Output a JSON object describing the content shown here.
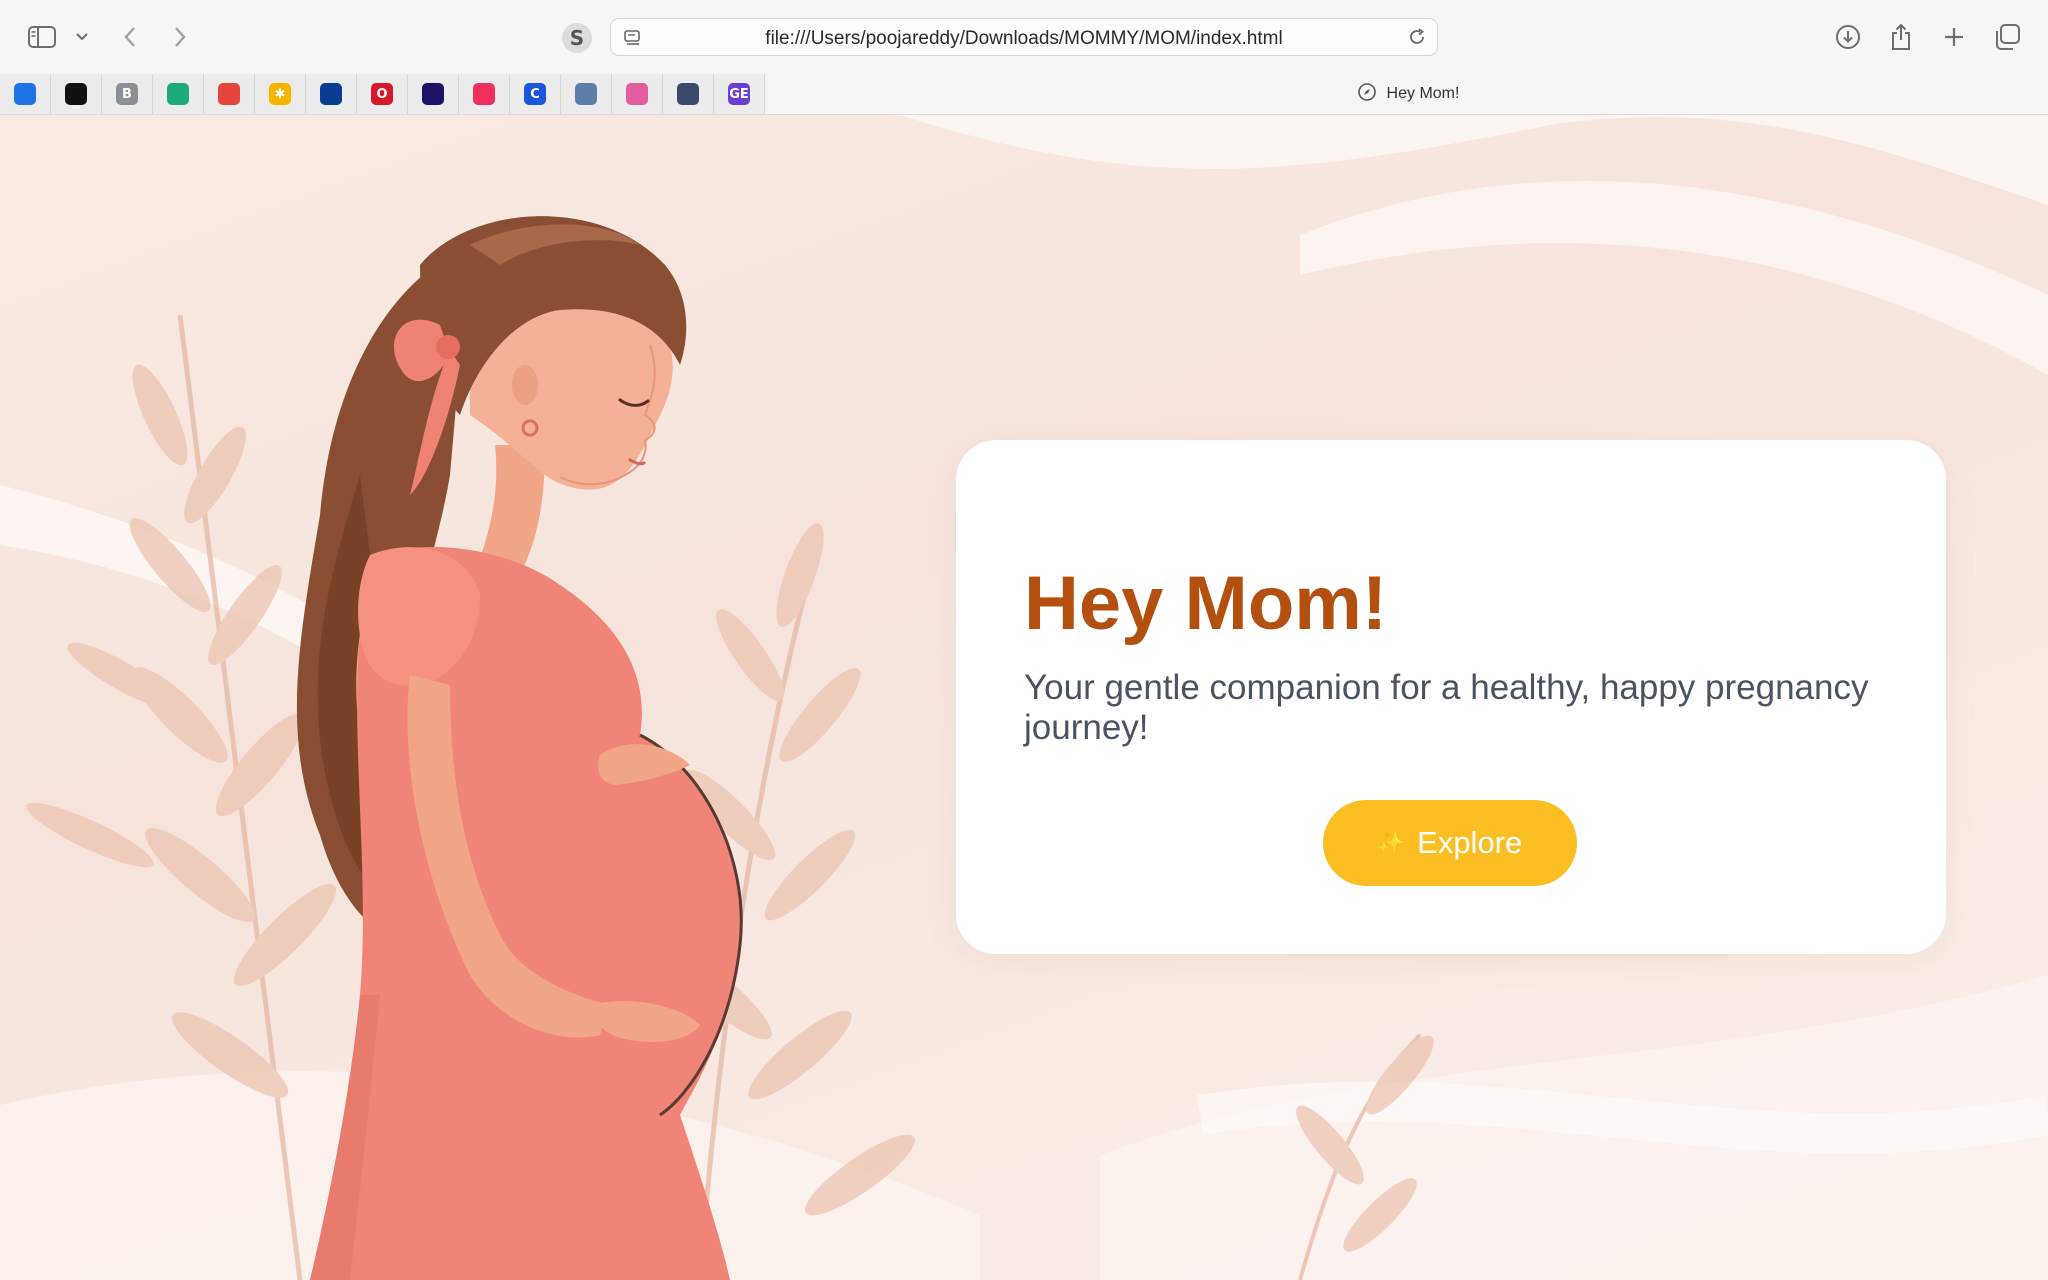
{
  "browser": {
    "url": "file:///Users/poojareddy/Downloads/MOMMY/MOM/index.html",
    "site_badge": "S",
    "active_tab_title": "Hey Mom!",
    "pinned_tabs": [
      {
        "icon": "circle-c-icon",
        "color": "#1e73e8",
        "glyph": ""
      },
      {
        "icon": "github-icon",
        "color": "#111111",
        "glyph": ""
      },
      {
        "icon": "b-icon",
        "color": "#8a8f98",
        "glyph": "B"
      },
      {
        "icon": "robot-icon",
        "color": "#1faa7a",
        "glyph": ""
      },
      {
        "icon": "chrome-icon",
        "color": "#e8453c",
        "glyph": ""
      },
      {
        "icon": "walmart-icon",
        "color": "#f7b500",
        "glyph": "✱"
      },
      {
        "icon": "skier-icon",
        "color": "#0a3d91",
        "glyph": ""
      },
      {
        "icon": "opera-icon",
        "color": "#d7192b",
        "glyph": "O"
      },
      {
        "icon": "camera-icon",
        "color": "#1b1464",
        "glyph": ""
      },
      {
        "icon": "feather-icon",
        "color": "#f0305c",
        "glyph": ""
      },
      {
        "icon": "c-icon",
        "color": "#1a56db",
        "glyph": "C"
      },
      {
        "icon": "brain-icon",
        "color": "#5b7fa8",
        "glyph": ""
      },
      {
        "icon": "gradient-icon",
        "color": "#e25c9e",
        "glyph": ""
      },
      {
        "icon": "seal-icon",
        "color": "#3a4a6b",
        "glyph": ""
      },
      {
        "icon": "ge-icon",
        "color": "#6b3fd1",
        "glyph": "GE"
      }
    ]
  },
  "hero": {
    "title": "Hey Mom!",
    "subtitle": "Your gentle companion for a healthy, happy pregnancy journey!",
    "button_label": "Explore",
    "button_icon": "sparkle-icon"
  },
  "colors": {
    "title": "#b4500f",
    "button": "#fbbf24",
    "dress": "#f08577",
    "hair": "#8a4f32"
  }
}
